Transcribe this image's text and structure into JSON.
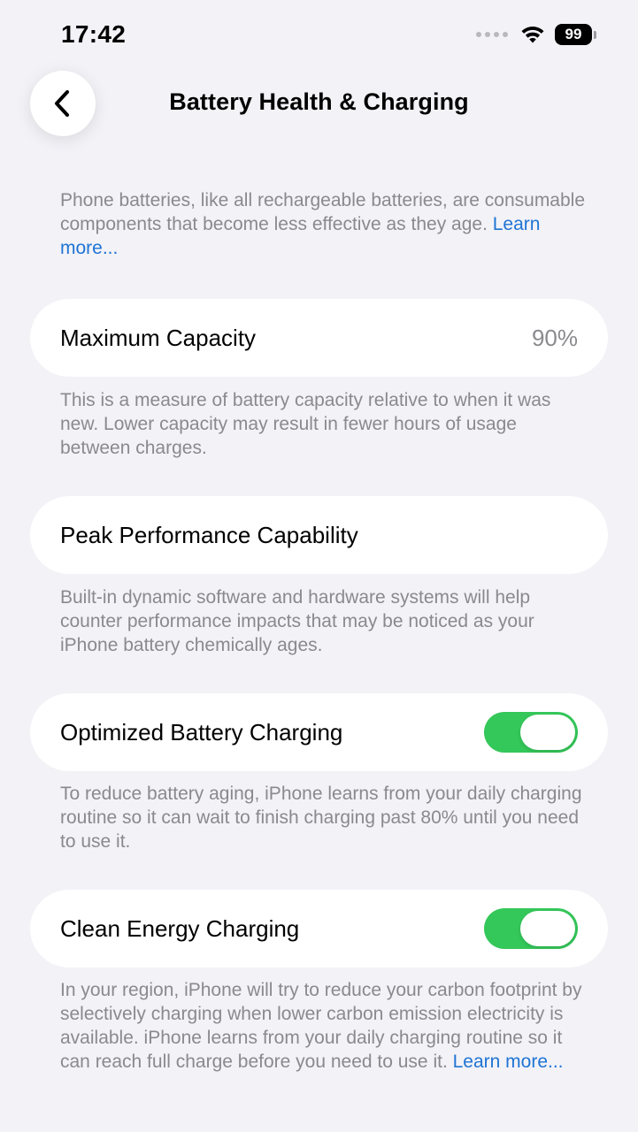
{
  "status_bar": {
    "time": "17:42",
    "battery_level": "99",
    "icons": [
      "signal-dots-icon",
      "wifi-icon",
      "battery-icon"
    ]
  },
  "nav": {
    "title": "Battery Health & Charging",
    "back_icon": "chevron-left-icon"
  },
  "intro": {
    "text": "Phone batteries, like all rechargeable batteries, are consumable components that become less effective as they age. ",
    "link": "Learn more..."
  },
  "maximum_capacity": {
    "label": "Maximum Capacity",
    "value": "90%",
    "description": "This is a measure of battery capacity relative to when it was new. Lower capacity may result in fewer hours of usage between charges."
  },
  "peak_performance": {
    "label": "Peak Performance Capability",
    "description": "Built-in dynamic software and hardware systems will help counter performance impacts that may be noticed as your iPhone battery chemically ages."
  },
  "optimized_charging": {
    "label": "Optimized Battery Charging",
    "enabled": true,
    "description": "To reduce battery aging, iPhone learns from your daily charging routine so it can wait to finish charging past 80% until you need to use it."
  },
  "clean_energy": {
    "label": "Clean Energy Charging",
    "enabled": true,
    "description": "In your region, iPhone will try to reduce your carbon footprint by selectively charging when lower carbon emission electricity is available. iPhone learns from your daily charging routine so it can reach full charge before you need to use it. ",
    "link": "Learn more..."
  },
  "colors": {
    "background": "#f2f2f7",
    "card": "#ffffff",
    "secondary_text": "#8a8a8e",
    "link": "#1f74d4",
    "toggle_on": "#34c759"
  }
}
